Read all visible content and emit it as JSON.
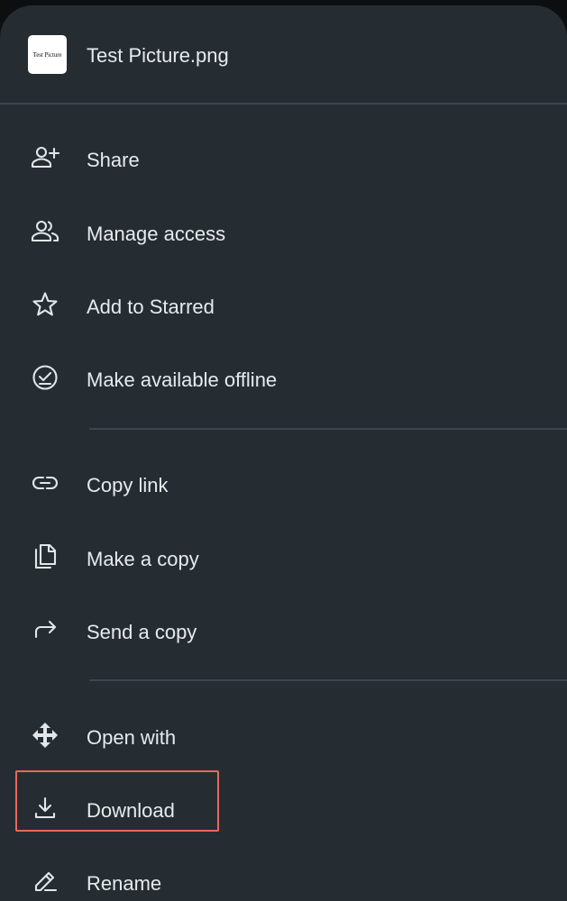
{
  "header": {
    "thumbnail_text": "Test Picture",
    "file_name": "Test Picture.png"
  },
  "menu": {
    "items": [
      {
        "label": "Share",
        "icon": "person-add-icon"
      },
      {
        "label": "Manage access",
        "icon": "people-icon"
      },
      {
        "label": "Add to Starred",
        "icon": "star-outline-icon"
      },
      {
        "label": "Make available offline",
        "icon": "offline-check-icon"
      },
      {
        "label": "Copy link",
        "icon": "link-icon"
      },
      {
        "label": "Make a copy",
        "icon": "copy-icon"
      },
      {
        "label": "Send a copy",
        "icon": "forward-arrow-icon"
      },
      {
        "label": "Open with",
        "icon": "open-with-arrows-icon"
      },
      {
        "label": "Download",
        "icon": "download-icon"
      },
      {
        "label": "Rename",
        "icon": "pencil-rename-icon"
      }
    ]
  },
  "highlight": {
    "target": "Download",
    "color": "#e8685c"
  },
  "colors": {
    "sheet_background": "#252d33",
    "text": "#e8eaed",
    "divider": "#3d464d"
  }
}
